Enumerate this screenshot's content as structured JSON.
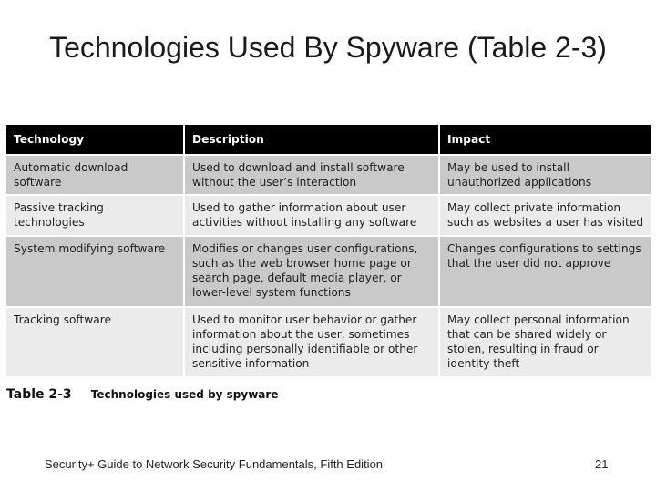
{
  "slide": {
    "title": "Technologies Used By Spyware (Table 2-3)",
    "footer_text": "Security+ Guide to Network Security Fundamentals, Fifth Edition",
    "page_number": "21"
  },
  "table": {
    "headers": [
      "Technology",
      "Description",
      "Impact"
    ],
    "rows": [
      [
        "Automatic download software",
        "Used to download and install software without the user’s interaction",
        "May be used to install unauthorized applications"
      ],
      [
        "Passive tracking technologies",
        "Used to gather information about user activities without installing any software",
        "May collect private information such as websites a user has visited"
      ],
      [
        "System modifying software",
        "Modifies or changes user configurations, such as the web browser home page or search page, default media player, or lower-level system functions",
        "Changes configurations to settings that the user did not approve"
      ],
      [
        "Tracking software",
        "Used to monitor user behavior or gather information about the user, sometimes including personally identifiable or other sensitive information",
        "May collect personal information that can be shared widely or stolen, resulting in fraud or identity theft"
      ]
    ],
    "caption_number": "Table 2-3",
    "caption_text": "Technologies used by spyware"
  }
}
